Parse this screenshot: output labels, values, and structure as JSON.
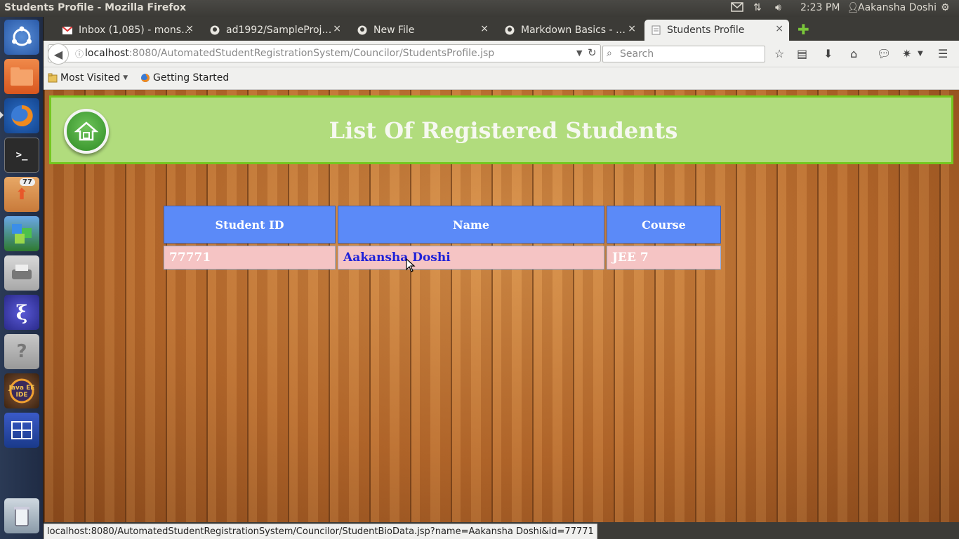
{
  "window": {
    "title": "Students Profile - Mozilla Firefox"
  },
  "system_tray": {
    "time": "2:23 PM",
    "user": "Aakansha Doshi"
  },
  "launcher": {
    "badge_count": "77"
  },
  "tabs": [
    {
      "label": "Inbox (1,085) - mons…",
      "icon": "gmail-icon",
      "active": false
    },
    {
      "label": "ad1992/SampleProj…",
      "icon": "github-icon",
      "active": false
    },
    {
      "label": "New File",
      "icon": "github-icon",
      "active": false
    },
    {
      "label": "Markdown Basics - …",
      "icon": "github-icon",
      "active": false
    },
    {
      "label": "Students Profile",
      "icon": "page-icon",
      "active": true
    }
  ],
  "navbar": {
    "url_host": "localhost",
    "url_rest": ":8080/AutomatedStudentRegistrationSystem/Councilor/StudentsProfile.jsp",
    "search_placeholder": "Search"
  },
  "bookmarks": [
    {
      "label": "Most Visited"
    },
    {
      "label": "Getting Started"
    }
  ],
  "page": {
    "title": "List Of Registered Students",
    "table": {
      "headers": [
        "Student ID",
        "Name",
        "Course"
      ],
      "rows": [
        {
          "id": "77771",
          "name": "Aakansha Doshi",
          "course": "JEE 7"
        }
      ]
    }
  },
  "statusbar": {
    "text": "localhost:8080/AutomatedStudentRegistrationSystem/Councilor/StudentBioData.jsp?name=Aakansha  Doshi&id=77771"
  }
}
